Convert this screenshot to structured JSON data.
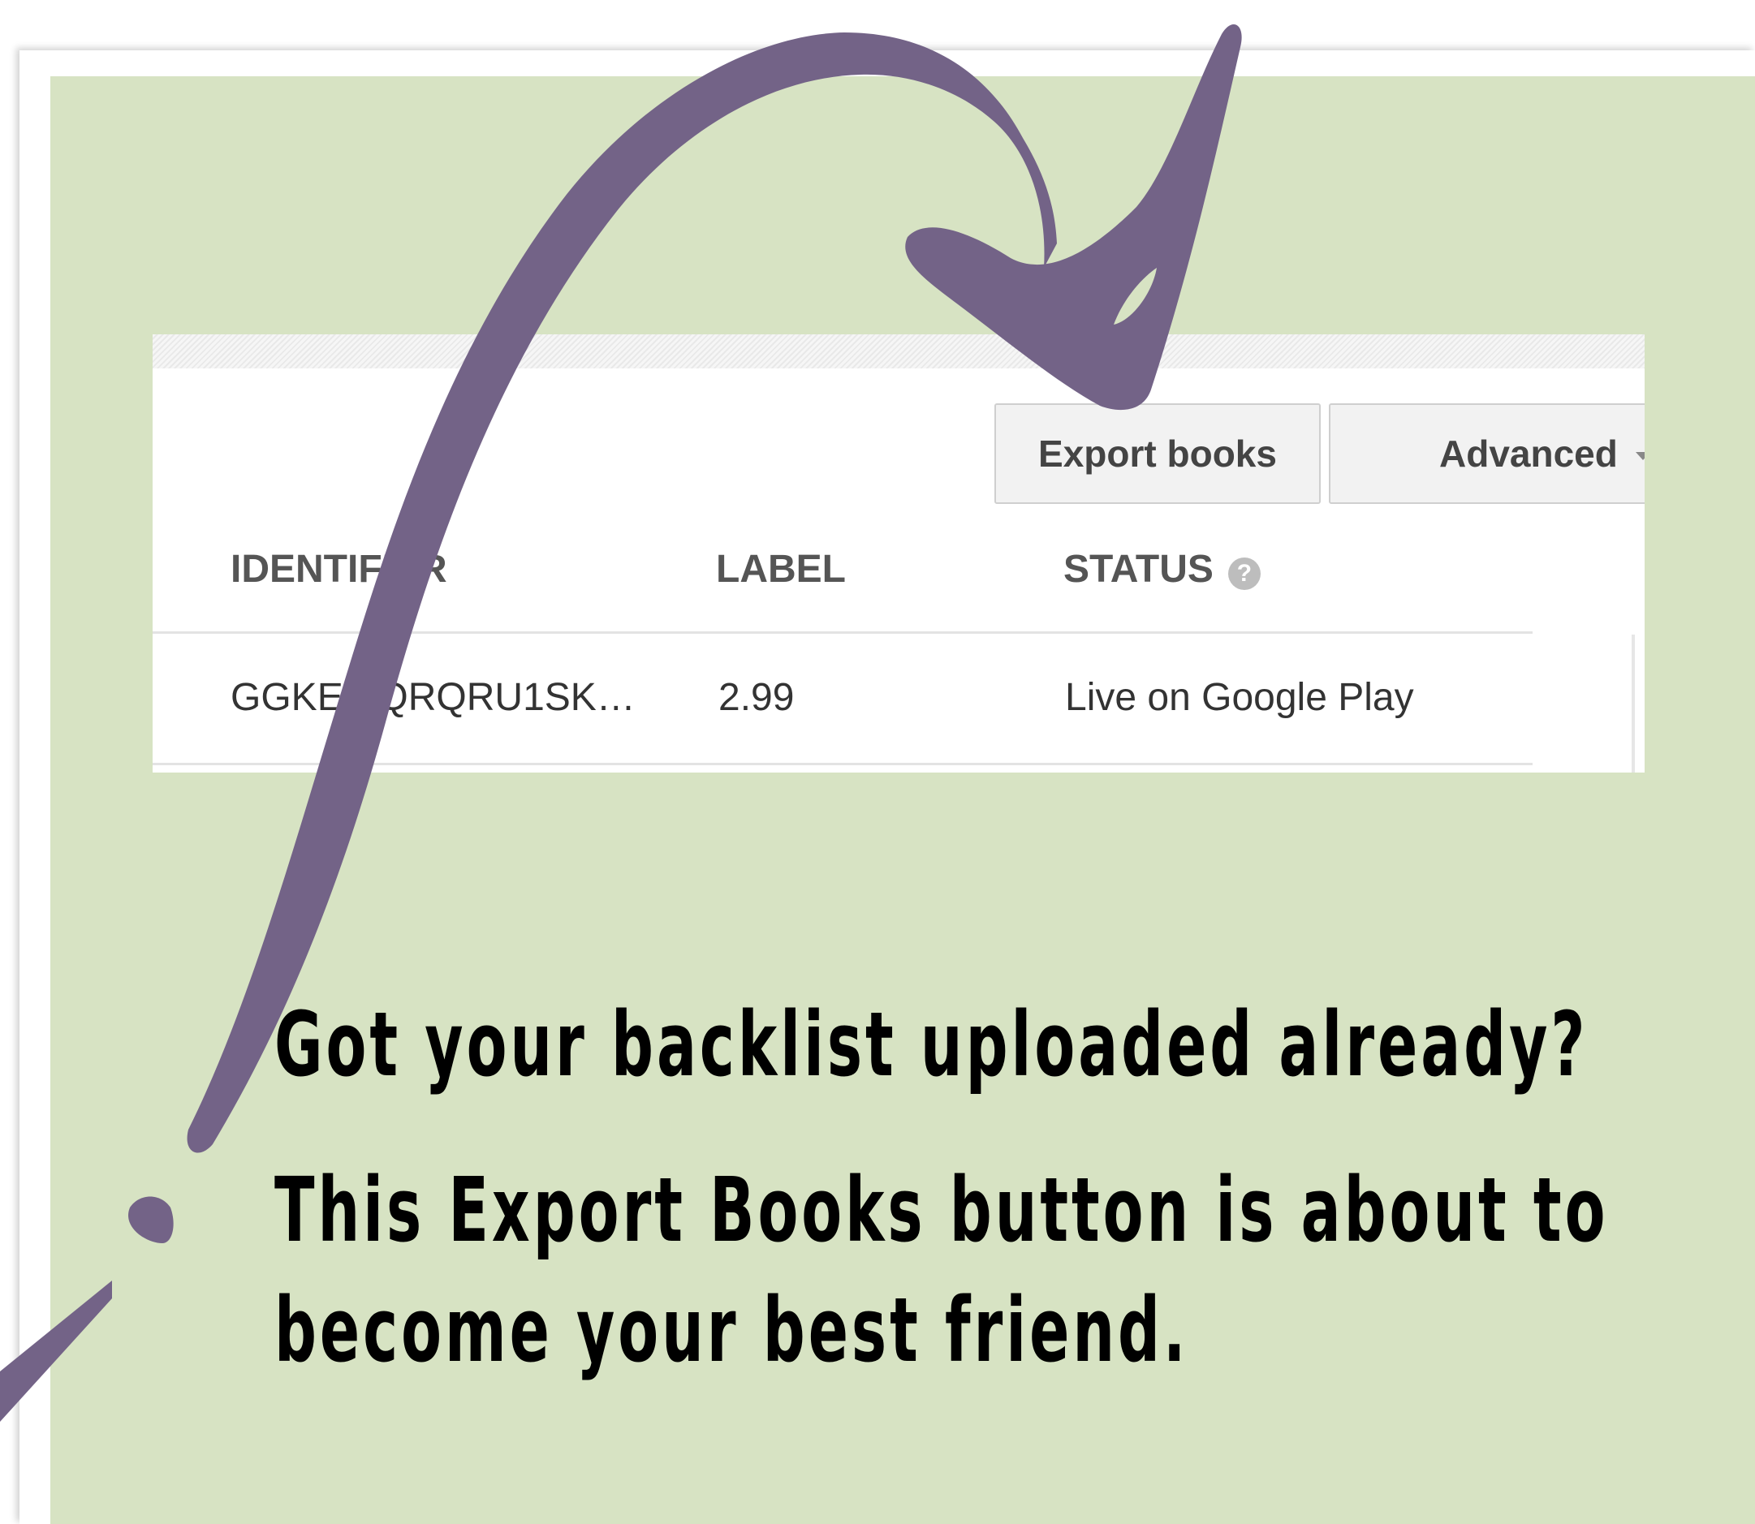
{
  "ui": {
    "export_button": "Export books",
    "advanced_button": "Advanced",
    "columns": {
      "identifier": "IDENTIFIER",
      "label": "LABEL",
      "status": "STATUS",
      "help_glyph": "?"
    },
    "row": {
      "identifier": "GGKEY:QRQRU1SK…",
      "label": "2.99",
      "status": "Live on Google Play"
    }
  },
  "caption": {
    "line1": "Got your backlist uploaded already?",
    "line2": "This Export Books button is about to",
    "line3": "become your best friend."
  },
  "colors": {
    "panel_background": "#d7e3c3",
    "arrow": "#736387",
    "caption_text": "#000000"
  },
  "icons": {
    "arrow": "hand-drawn-curved-arrow",
    "dropdown": "caret-down",
    "help": "question-circle"
  }
}
